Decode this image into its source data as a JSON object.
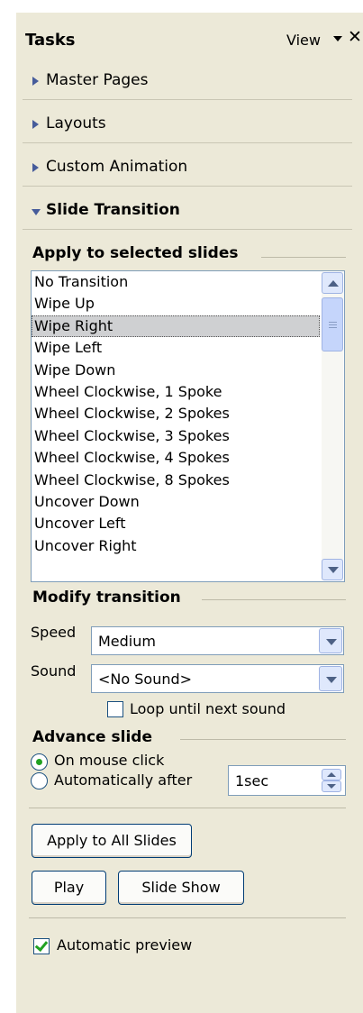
{
  "header": {
    "title": "Tasks",
    "view_label": "View",
    "close_glyph": "✕"
  },
  "decks": [
    {
      "label": "Master Pages",
      "expanded": false
    },
    {
      "label": "Layouts",
      "expanded": false
    },
    {
      "label": "Custom Animation",
      "expanded": false
    },
    {
      "label": "Slide Transition",
      "expanded": true
    }
  ],
  "apply": {
    "heading": "Apply to selected slides",
    "selected": "Wipe Right",
    "items": [
      "No Transition",
      "Wipe Up",
      "Wipe Right",
      "Wipe Left",
      "Wipe Down",
      "Wheel Clockwise, 1 Spoke",
      "Wheel Clockwise, 2 Spokes",
      "Wheel Clockwise, 3 Spokes",
      "Wheel Clockwise, 4 Spokes",
      "Wheel Clockwise, 8 Spokes",
      "Uncover Down",
      "Uncover Left",
      "Uncover Right"
    ]
  },
  "modify": {
    "heading": "Modify transition",
    "speed_label": "Speed",
    "speed_value": "Medium",
    "sound_label": "Sound",
    "sound_value": "<No Sound>",
    "loop_label": "Loop until next sound",
    "loop_checked": false
  },
  "advance": {
    "heading": "Advance slide",
    "on_click_label": "On mouse click",
    "auto_label": "Automatically after",
    "auto_value": "1sec",
    "selected": "on_click"
  },
  "buttons": {
    "apply_all": "Apply to All Slides",
    "play": "Play",
    "slide_show": "Slide Show"
  },
  "preview": {
    "label": "Automatic preview",
    "checked": true
  },
  "colors": {
    "panel": "#ece9d8",
    "accent_check": "#21a121",
    "list_border": "#7f9db9",
    "selected_row": "#cfd0d2"
  }
}
